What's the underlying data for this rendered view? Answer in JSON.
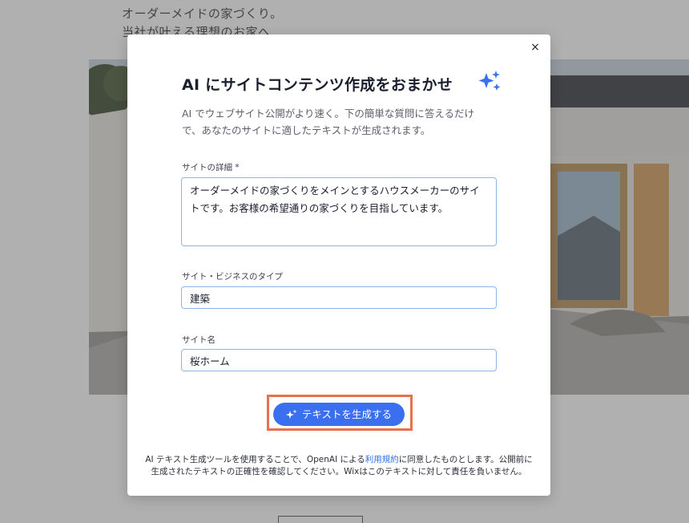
{
  "background": {
    "heading_line1": "オーダーメイドの家づくり。",
    "heading_line2": "当社が叶える理想のお家へ",
    "button_label": ""
  },
  "modal": {
    "title": "AI にサイトコンテンツ作成をおまかせ",
    "title_icon": "sparkle-icon",
    "close_label": "×",
    "description": "AI でウェブサイト公開がより速く。下の簡単な質問に答えるだけで、あなたのサイトに適したテキストが生成されます。",
    "fields": {
      "details_label": "サイトの詳細 *",
      "details_value": "オーダーメイドの家づくりをメインとするハウスメーカーのサイトです。お客様の希望通りの家づくりを目指しています。",
      "business_type_label": "サイト・ビジネスのタイプ",
      "business_type_value": "建築",
      "site_name_label": "サイト名",
      "site_name_value": "桜ホーム"
    },
    "generate_button_label": "テキストを生成する",
    "disclaimer": {
      "before_link": "AI テキスト生成ツールを使用することで、OpenAI による",
      "link": "利用規約",
      "after_link": "に同意したものとします。公開前に生成されたテキストの正確性を確認してください。Wixはこのテキストに対して責任を負いません。"
    }
  },
  "colors": {
    "accent": "#3a6ff0",
    "highlight": "#e8704f",
    "link": "#2f6fe8"
  }
}
